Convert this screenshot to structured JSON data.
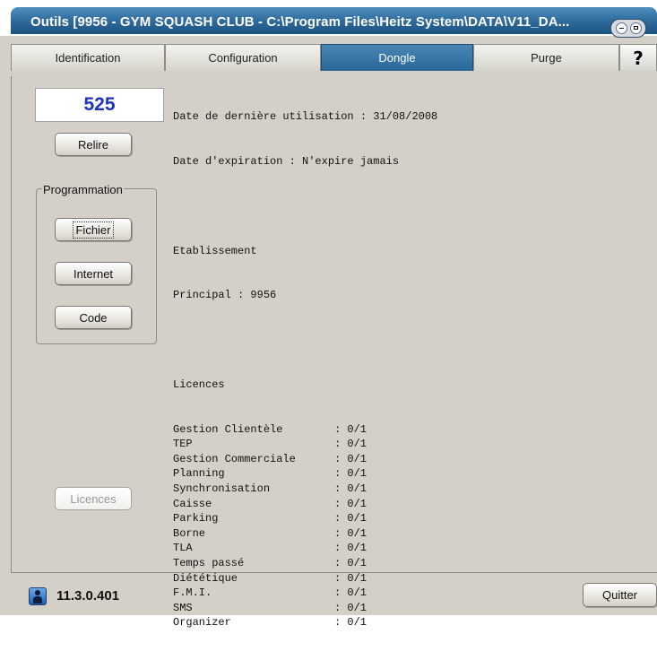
{
  "window": {
    "title": "Outils [9956 - GYM SQUASH CLUB - C:\\Program Files\\Heitz System\\DATA\\V11_DA..."
  },
  "tabs": [
    {
      "label": "Identification",
      "active": false
    },
    {
      "label": "Configuration",
      "active": false
    },
    {
      "label": "Dongle",
      "active": true
    },
    {
      "label": "Purge",
      "active": false
    }
  ],
  "help": {
    "label": "?"
  },
  "left_panel": {
    "counter": "525",
    "reload_label": "Relire",
    "group_title": "Programmation",
    "file_label": "Fichier",
    "internet_label": "Internet",
    "code_label": "Code",
    "licences_label": "Licences"
  },
  "dongle": {
    "last_use": "Date de dernière utilisation : 31/08/2008",
    "expiration": "Date d'expiration : N'expire jamais",
    "establishment_header": "Etablissement",
    "principal": "Principal : 9956",
    "licences_header": "Licences",
    "licences": [
      {
        "name": "Gestion Clientèle",
        "value": ": 0/1"
      },
      {
        "name": "TEP",
        "value": ": 0/1"
      },
      {
        "name": "Gestion Commerciale",
        "value": ": 0/1"
      },
      {
        "name": "Planning",
        "value": ": 0/1"
      },
      {
        "name": "Synchronisation",
        "value": ": 0/1"
      },
      {
        "name": "Caisse",
        "value": ": 0/1"
      },
      {
        "name": "Parking",
        "value": ": 0/1"
      },
      {
        "name": "Borne",
        "value": ": 0/1"
      },
      {
        "name": "TLA",
        "value": ": 0/1"
      },
      {
        "name": "Temps passé",
        "value": ": 0/1"
      },
      {
        "name": "Diététique",
        "value": ": 0/1"
      },
      {
        "name": "F.M.I.",
        "value": ": 0/1"
      },
      {
        "name": "SMS",
        "value": ": 0/1"
      },
      {
        "name": "Organizer",
        "value": ": 0/1"
      }
    ]
  },
  "footer": {
    "version": "11.3.0.401",
    "quit_label": "Quitter",
    "user_icon": "user-icon"
  },
  "colors": {
    "accent_tab": "#2a6697",
    "counter_text": "#1f34b8"
  }
}
